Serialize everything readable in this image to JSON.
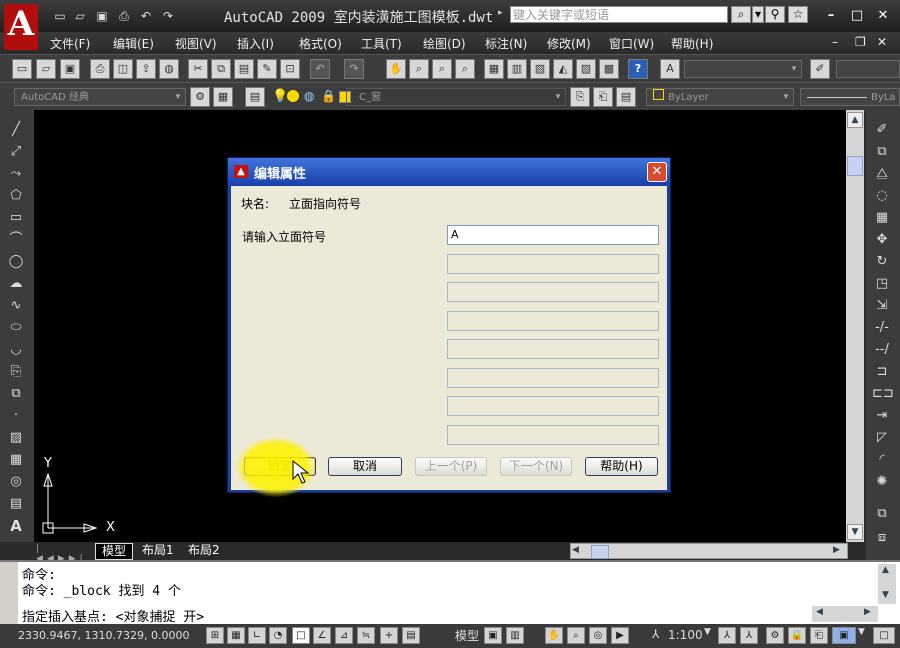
{
  "app": {
    "logo_letter": "A",
    "title": "AutoCAD 2009  室内装潢施工图模板.dwt",
    "search_placeholder": "键入关键字或短语"
  },
  "menu": [
    "文件(F)",
    "编辑(E)",
    "视图(V)",
    "插入(I)",
    "格式(O)",
    "工具(T)",
    "绘图(D)",
    "标注(N)",
    "修改(M)",
    "窗口(W)",
    "帮助(H)"
  ],
  "toolbar2": {
    "workspace": "AutoCAD 经典",
    "layer": "C_窗",
    "color": "ByLayer",
    "linetype": "ByLa"
  },
  "dialog": {
    "title": "编辑属性",
    "block_name_label": "块名:",
    "block_name_value": "立面指向符号",
    "prompt_label": "请输入立面符号",
    "prompt_value": "A",
    "buttons": {
      "ok": "确定",
      "cancel": "取消",
      "prev": "上一个(P)",
      "next": "下一个(N)",
      "help": "帮助(H)"
    }
  },
  "ucs": {
    "x": "X",
    "y": "Y"
  },
  "layout_tabs": [
    "模型",
    "布局1",
    "布局2"
  ],
  "command_lines": [
    "命令:",
    "命令: _block 找到 4 个",
    "指定插入基点: <对象捕捉 开>"
  ],
  "status": {
    "coords": "2330.9467, 1310.7329, 0.0000",
    "model_label": "模型",
    "scale": "1:100"
  },
  "colors": {
    "canvas": "#000000",
    "dialog_title": "#1b3fa8",
    "dialog_body": "#ece9d8",
    "highlight": "#fff200",
    "brand": "#b20d0d"
  }
}
